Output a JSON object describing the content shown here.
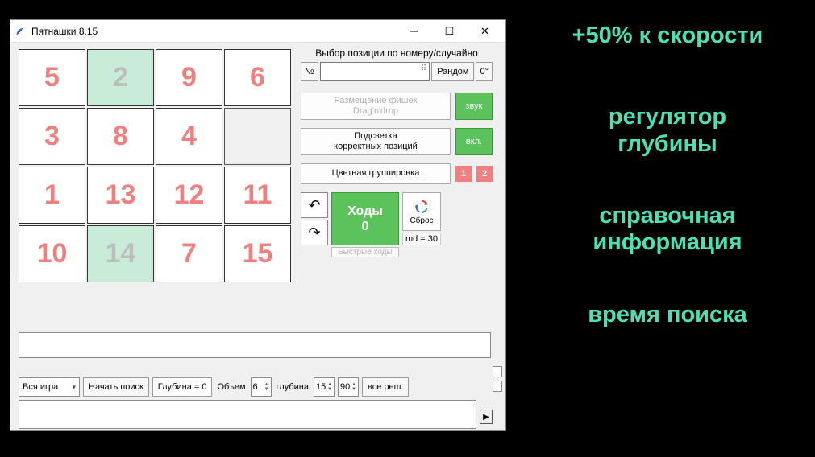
{
  "window": {
    "title": "Пятнашки 8.15"
  },
  "board": {
    "tiles": [
      {
        "v": "5",
        "correct": false
      },
      {
        "v": "2",
        "correct": true
      },
      {
        "v": "9",
        "correct": false
      },
      {
        "v": "6",
        "correct": false
      },
      {
        "v": "3",
        "correct": false
      },
      {
        "v": "8",
        "correct": false
      },
      {
        "v": "4",
        "correct": false
      },
      {
        "v": "",
        "empty": true
      },
      {
        "v": "1",
        "correct": false
      },
      {
        "v": "13",
        "correct": false
      },
      {
        "v": "12",
        "correct": false
      },
      {
        "v": "11",
        "correct": false
      },
      {
        "v": "10",
        "correct": false
      },
      {
        "v": "14",
        "correct": true
      },
      {
        "v": "7",
        "correct": false
      },
      {
        "v": "15",
        "correct": false
      }
    ]
  },
  "selector": {
    "heading": "Выбор позиции по номеру/случайно",
    "num_btn": "№",
    "random_btn": "Рандом",
    "zero_btn": "0°"
  },
  "options": {
    "placement": "Размещение фишек\nDrag'n'drop",
    "sound": "звук",
    "highlight": "Подсветка корректных позиций",
    "on": "вкл.",
    "color_group": "Цветная группировка",
    "badge1": "1",
    "badge2": "2"
  },
  "controls": {
    "moves_label": "Ходы",
    "moves_value": "0",
    "reset": "Сброс",
    "md": "md = 30",
    "fast": "Быстрые ходы"
  },
  "search": {
    "scope": "Вся игра",
    "start": "Начать поиск",
    "depth_lbl": "Глубина = 0",
    "volume_lbl": "Объем",
    "volume_val": "6",
    "depth2_lbl": "глубина",
    "depth2_val": "15",
    "depth3_val": "90",
    "all": "все реш."
  },
  "side": {
    "l1": "+50% к скорости",
    "l2a": "регулятор",
    "l2b": "глубины",
    "l3a": "справочная",
    "l3b": "информация",
    "l4": "время поиска"
  }
}
